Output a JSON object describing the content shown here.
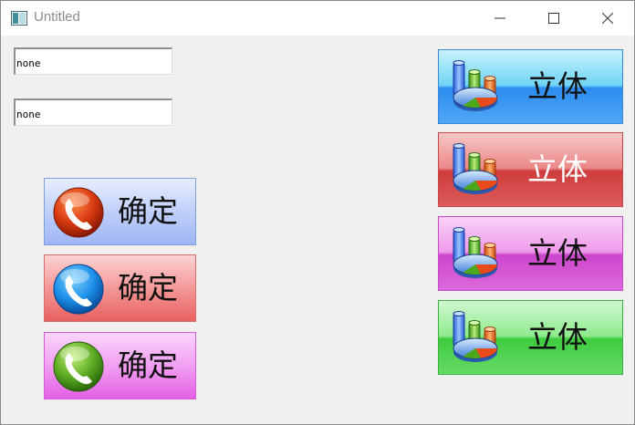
{
  "window": {
    "title": "Untitled",
    "icon": "app-window-icon",
    "controls": [
      "minimize-icon",
      "maximize-icon",
      "close-icon"
    ]
  },
  "inputs": [
    {
      "value": "none"
    },
    {
      "value": "none"
    }
  ],
  "phone_buttons": [
    {
      "label": "确定",
      "icon": "phone-icon",
      "icon_color": "#d83a10",
      "gradient": [
        "#e7eeff",
        "#9eb6f4"
      ]
    },
    {
      "label": "确定",
      "icon": "phone-icon",
      "icon_color": "#1b8fe8",
      "gradient": [
        "#fbd2d2",
        "#ea6060"
      ]
    },
    {
      "label": "确定",
      "icon": "phone-icon",
      "icon_color": "#5aab22",
      "gradient": [
        "#fbd6fb",
        "#e35fe4"
      ]
    }
  ],
  "chart_buttons": [
    {
      "label": "立体",
      "icon": "3d-chart-icon",
      "label_color": "#111111",
      "gradient": [
        "#c8f2fc",
        "#2c8cf0"
      ]
    },
    {
      "label": "立体",
      "icon": "3d-chart-icon",
      "label_color": "#ffffff",
      "gradient": [
        "#f8c6c6",
        "#cf3c3c"
      ]
    },
    {
      "label": "立体",
      "icon": "3d-chart-icon",
      "label_color": "#111111",
      "gradient": [
        "#f8d2f6",
        "#cc45cc"
      ]
    },
    {
      "label": "立体",
      "icon": "3d-chart-icon",
      "label_color": "#111111",
      "gradient": [
        "#d0f7d0",
        "#3fcc3f"
      ]
    }
  ]
}
